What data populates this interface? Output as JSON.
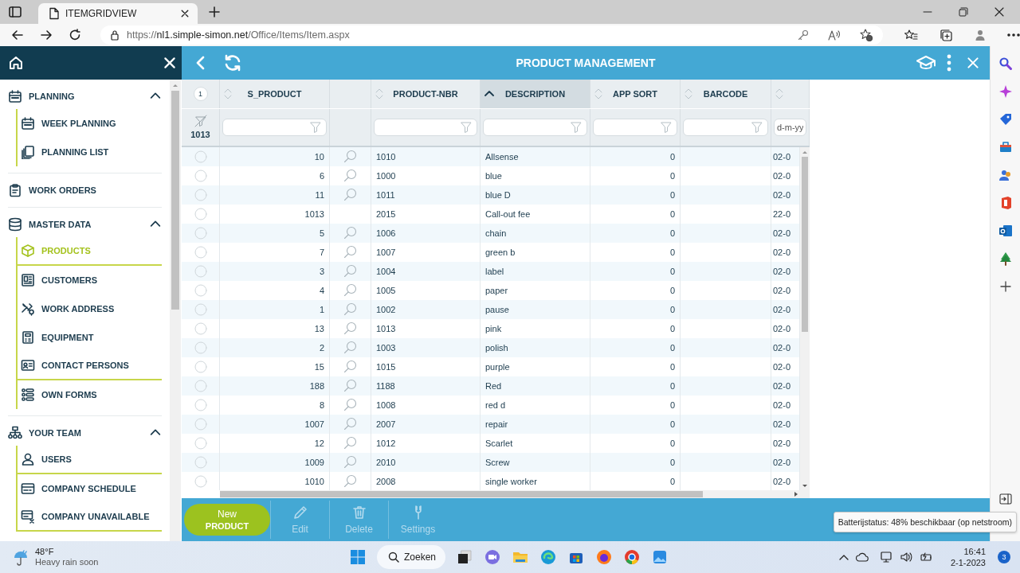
{
  "browser": {
    "tab_title": "ITEMGRIDVIEW",
    "url": {
      "scheme": "https://",
      "host": "nl1.simple-simon.net",
      "path": "/Office/Items/Item.aspx"
    }
  },
  "app": {
    "title": "PRODUCT MANAGEMENT"
  },
  "sidebar": {
    "items": [
      {
        "kind": "group",
        "label": "PLANNING",
        "expanded": true,
        "children": [
          {
            "label": "WEEK PLANNING",
            "selected": false,
            "underlined": false
          },
          {
            "label": "PLANNING LIST",
            "selected": false,
            "underlined": false
          }
        ]
      },
      {
        "kind": "link",
        "label": "WORK ORDERS"
      },
      {
        "kind": "group",
        "label": "MASTER DATA",
        "expanded": true,
        "children": [
          {
            "label": "PRODUCTS",
            "selected": true,
            "underlined": true
          },
          {
            "label": "CUSTOMERS",
            "selected": false,
            "underlined": false
          },
          {
            "label": "WORK ADDRESS",
            "selected": false,
            "underlined": false
          },
          {
            "label": "EQUIPMENT",
            "selected": false,
            "underlined": false
          },
          {
            "label": "CONTACT PERSONS",
            "selected": false,
            "underlined": true
          },
          {
            "label": "OWN FORMS",
            "selected": false,
            "underlined": false
          }
        ]
      },
      {
        "kind": "group",
        "label": "YOUR TEAM",
        "expanded": true,
        "children": [
          {
            "label": "USERS",
            "selected": false,
            "underlined": true
          },
          {
            "label": "COMPANY SCHEDULE",
            "selected": false,
            "underlined": false
          },
          {
            "label": "COMPANY UNAVAILABLE",
            "selected": false,
            "underlined": true
          }
        ]
      }
    ]
  },
  "grid": {
    "columns": [
      {
        "kind": "select",
        "badge": "1",
        "count": "1013"
      },
      {
        "kind": "data",
        "label": "S_PRODUCT",
        "sorted": false
      },
      {
        "kind": "lookup"
      },
      {
        "kind": "data",
        "label": "PRODUCT-NBR",
        "sorted": false
      },
      {
        "kind": "data",
        "label": "DESCRIPTION",
        "sorted": true
      },
      {
        "kind": "data",
        "label": "APP SORT",
        "sorted": false
      },
      {
        "kind": "data",
        "label": "BARCODE",
        "sorted": false
      },
      {
        "kind": "data",
        "sorted": false,
        "placeholder": "d-m-yy"
      }
    ],
    "rows": [
      {
        "selected": false,
        "s_product": "10",
        "lookup": true,
        "product_nbr": "1010",
        "description": "Allsense",
        "app_sort": "0",
        "column_8": "02-0"
      },
      {
        "selected": false,
        "s_product": "6",
        "lookup": true,
        "product_nbr": "1000",
        "description": "blue",
        "app_sort": "0",
        "column_8": "02-0"
      },
      {
        "selected": false,
        "s_product": "11",
        "lookup": true,
        "product_nbr": "1011",
        "description": "blue D",
        "app_sort": "0",
        "column_8": "02-0"
      },
      {
        "selected": false,
        "s_product": "1013",
        "lookup": false,
        "product_nbr": "2015",
        "description": "Call-out fee",
        "app_sort": "0",
        "column_8": "22-0"
      },
      {
        "selected": false,
        "s_product": "5",
        "lookup": true,
        "product_nbr": "1006",
        "description": "chain",
        "app_sort": "0",
        "column_8": "02-0"
      },
      {
        "selected": false,
        "s_product": "7",
        "lookup": true,
        "product_nbr": "1007",
        "description": "green b",
        "app_sort": "0",
        "column_8": "02-0"
      },
      {
        "selected": false,
        "s_product": "3",
        "lookup": true,
        "product_nbr": "1004",
        "description": "label",
        "app_sort": "0",
        "column_8": "02-0"
      },
      {
        "selected": false,
        "s_product": "4",
        "lookup": true,
        "product_nbr": "1005",
        "description": "paper",
        "app_sort": "0",
        "column_8": "02-0"
      },
      {
        "selected": false,
        "s_product": "1",
        "lookup": true,
        "product_nbr": "1002",
        "description": "pause",
        "app_sort": "0",
        "column_8": "02-0"
      },
      {
        "selected": false,
        "s_product": "13",
        "lookup": true,
        "product_nbr": "1013",
        "description": "pink",
        "app_sort": "0",
        "column_8": "02-0"
      },
      {
        "selected": false,
        "s_product": "2",
        "lookup": true,
        "product_nbr": "1003",
        "description": "polish",
        "app_sort": "0",
        "column_8": "02-0"
      },
      {
        "selected": false,
        "s_product": "15",
        "lookup": true,
        "product_nbr": "1015",
        "description": "purple",
        "app_sort": "0",
        "column_8": "02-0"
      },
      {
        "selected": false,
        "s_product": "188",
        "lookup": true,
        "product_nbr": "1188",
        "description": "Red",
        "app_sort": "0",
        "column_8": "02-0"
      },
      {
        "selected": false,
        "s_product": "8",
        "lookup": true,
        "product_nbr": "1008",
        "description": "red d",
        "app_sort": "0",
        "column_8": "02-0"
      },
      {
        "selected": false,
        "s_product": "1007",
        "lookup": true,
        "product_nbr": "2007",
        "description": "repair",
        "app_sort": "0",
        "column_8": "02-0"
      },
      {
        "selected": false,
        "s_product": "12",
        "lookup": true,
        "product_nbr": "1012",
        "description": "Scarlet",
        "app_sort": "0",
        "column_8": "02-0"
      },
      {
        "selected": false,
        "s_product": "1009",
        "lookup": true,
        "product_nbr": "2010",
        "description": "Screw",
        "app_sort": "0",
        "column_8": "02-0"
      },
      {
        "selected": false,
        "s_product": "1010",
        "lookup": true,
        "product_nbr": "2008",
        "description": "single worker",
        "app_sort": "0",
        "column_8": "02-0"
      }
    ]
  },
  "actions": [
    {
      "kind": "primary",
      "label": "New",
      "sublabel": "PRODUCT",
      "disabled": false
    },
    {
      "kind": "tool",
      "label": "Edit",
      "disabled": true
    },
    {
      "kind": "tool",
      "label": "Delete",
      "disabled": true
    },
    {
      "kind": "tool",
      "label": "Settings",
      "disabled": true
    }
  ],
  "tooltip": "Batterijstatus: 48% beschikbaar (op netstroom)",
  "taskbar": {
    "weather": {
      "temperature": "48°F",
      "forecast": "Heavy rain soon"
    },
    "search": "Zoeken",
    "time": "16:41",
    "date": "2-1-2023",
    "notifications": "3"
  }
}
